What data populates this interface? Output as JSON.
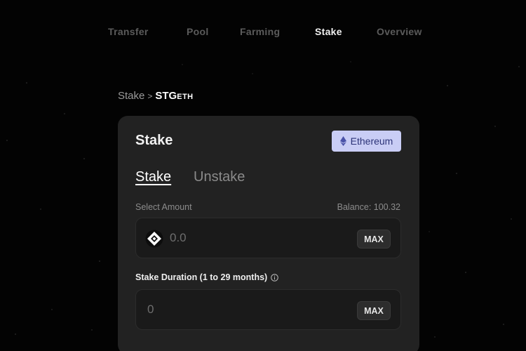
{
  "nav": {
    "items": [
      {
        "label": "Transfer"
      },
      {
        "label": "Pool"
      },
      {
        "label": "Farming"
      },
      {
        "label": "Stake"
      },
      {
        "label": "Overview"
      }
    ],
    "active": "Stake"
  },
  "breadcrumb": {
    "parent": "Stake",
    "separator": ">",
    "current_main": "STG",
    "current_sub": "ETH"
  },
  "card": {
    "title": "Stake",
    "chain_badge": {
      "label": "Ethereum",
      "icon": "ethereum-icon",
      "color": "#c9cdf5"
    },
    "tabs": [
      {
        "label": "Stake",
        "active": true
      },
      {
        "label": "Unstake",
        "active": false
      }
    ],
    "amount": {
      "label": "Select Amount",
      "balance": "Balance: 100.32",
      "placeholder": "0.0",
      "token_icon": "stargate-token-icon",
      "max_label": "MAX"
    },
    "duration": {
      "label": "Stake Duration (1 to 29 months)",
      "info_icon": "info-icon",
      "placeholder": "0",
      "max_label": "MAX"
    }
  }
}
